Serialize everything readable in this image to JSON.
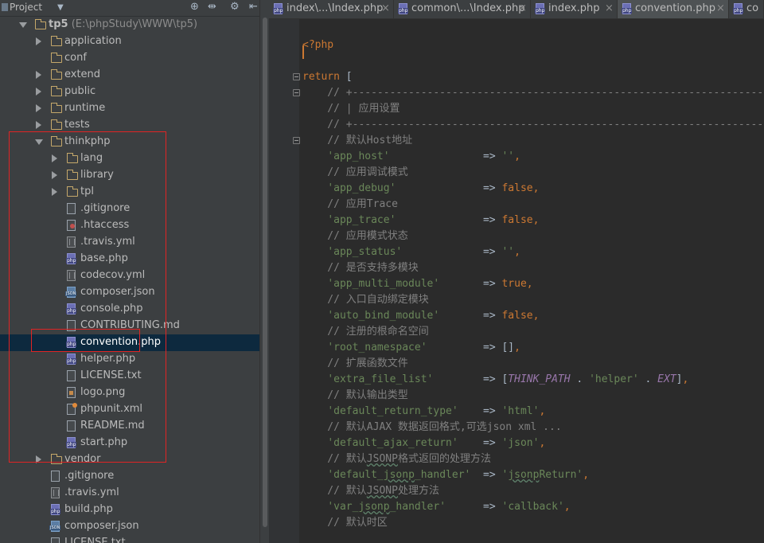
{
  "project_panel": {
    "title": "Project",
    "tree": [
      {
        "label": "tp5",
        "path": " (E:\\phpStudy\\WWW\\tp5)",
        "type": "folder",
        "depth": 0,
        "state": "expanded",
        "root": true
      },
      {
        "label": "application",
        "type": "folder",
        "depth": 1,
        "state": "collapsed"
      },
      {
        "label": "conf",
        "type": "folder",
        "depth": 1,
        "state": "none"
      },
      {
        "label": "extend",
        "type": "folder",
        "depth": 1,
        "state": "collapsed"
      },
      {
        "label": "public",
        "type": "folder",
        "depth": 1,
        "state": "collapsed"
      },
      {
        "label": "runtime",
        "type": "folder",
        "depth": 1,
        "state": "collapsed"
      },
      {
        "label": "tests",
        "type": "folder",
        "depth": 1,
        "state": "collapsed"
      },
      {
        "label": "thinkphp",
        "type": "folder",
        "depth": 1,
        "state": "expanded"
      },
      {
        "label": "lang",
        "type": "folder",
        "depth": 2,
        "state": "collapsed"
      },
      {
        "label": "library",
        "type": "folder",
        "depth": 2,
        "state": "collapsed"
      },
      {
        "label": "tpl",
        "type": "folder",
        "depth": 2,
        "state": "collapsed"
      },
      {
        "label": ".gitignore",
        "type": "file",
        "depth": 2
      },
      {
        "label": ".htaccess",
        "type": "htaccess",
        "depth": 2
      },
      {
        "label": ".travis.yml",
        "type": "yml",
        "depth": 2
      },
      {
        "label": "base.php",
        "type": "php",
        "depth": 2
      },
      {
        "label": "codecov.yml",
        "type": "yml",
        "depth": 2
      },
      {
        "label": "composer.json",
        "type": "json",
        "depth": 2
      },
      {
        "label": "console.php",
        "type": "php",
        "depth": 2
      },
      {
        "label": "CONTRIBUTING.md",
        "type": "file",
        "depth": 2
      },
      {
        "label": "convention.php",
        "type": "php",
        "depth": 2,
        "selected": true
      },
      {
        "label": "helper.php",
        "type": "php",
        "depth": 2
      },
      {
        "label": "LICENSE.txt",
        "type": "file",
        "depth": 2
      },
      {
        "label": "logo.png",
        "type": "img",
        "depth": 2
      },
      {
        "label": "phpunit.xml",
        "type": "xml",
        "depth": 2
      },
      {
        "label": "README.md",
        "type": "file",
        "depth": 2
      },
      {
        "label": "start.php",
        "type": "php",
        "depth": 2
      },
      {
        "label": "vendor",
        "type": "folder",
        "depth": 1,
        "state": "collapsed"
      },
      {
        "label": ".gitignore",
        "type": "file",
        "depth": 1
      },
      {
        "label": ".travis.yml",
        "type": "yml",
        "depth": 1
      },
      {
        "label": "build.php",
        "type": "php",
        "depth": 1
      },
      {
        "label": "composer.json",
        "type": "json",
        "depth": 1
      },
      {
        "label": "LICENSE.txt",
        "type": "file",
        "depth": 1
      }
    ]
  },
  "tabs": [
    {
      "label": "index\\...\\Index.php",
      "active": false
    },
    {
      "label": "common\\...\\Index.php",
      "active": false
    },
    {
      "label": "index.php",
      "active": false
    },
    {
      "label": "convention.php",
      "active": true
    },
    {
      "label": "co",
      "active": false
    }
  ],
  "tab_close_glyph": "×",
  "code_lines": [
    [],
    [
      {
        "t": "<?php",
        "c": "tag"
      }
    ],
    [],
    [
      {
        "t": "return ",
        "c": "kw"
      },
      {
        "t": "[",
        "c": "op"
      }
    ],
    [
      {
        "t": "    // +----------------------------------------------------------------------",
        "c": "cm"
      }
    ],
    [
      {
        "t": "    // | 应用设置",
        "c": "cm"
      }
    ],
    [
      {
        "t": "    // +----------------------------------------------------------------------",
        "c": "cm"
      }
    ],
    [
      {
        "t": "    // 默认Host地址",
        "c": "cm"
      }
    ],
    [
      {
        "t": "    ",
        "c": "op"
      },
      {
        "t": "'app_host'",
        "c": "str"
      },
      {
        "t": "               => ",
        "c": "op"
      },
      {
        "t": "''",
        "c": "str"
      },
      {
        "t": ",",
        "c": "kw"
      }
    ],
    [
      {
        "t": "    // 应用调试模式",
        "c": "cm"
      }
    ],
    [
      {
        "t": "    ",
        "c": "op"
      },
      {
        "t": "'app_debug'",
        "c": "str"
      },
      {
        "t": "              => ",
        "c": "op"
      },
      {
        "t": "false",
        "c": "kw"
      },
      {
        "t": ",",
        "c": "kw"
      }
    ],
    [
      {
        "t": "    // 应用Trace",
        "c": "cm"
      }
    ],
    [
      {
        "t": "    ",
        "c": "op"
      },
      {
        "t": "'app_trace'",
        "c": "str"
      },
      {
        "t": "              => ",
        "c": "op"
      },
      {
        "t": "false",
        "c": "kw"
      },
      {
        "t": ",",
        "c": "kw"
      }
    ],
    [
      {
        "t": "    // 应用模式状态",
        "c": "cm"
      }
    ],
    [
      {
        "t": "    ",
        "c": "op"
      },
      {
        "t": "'app_status'",
        "c": "str"
      },
      {
        "t": "             => ",
        "c": "op"
      },
      {
        "t": "''",
        "c": "str"
      },
      {
        "t": ",",
        "c": "kw"
      }
    ],
    [
      {
        "t": "    // 是否支持多模块",
        "c": "cm"
      }
    ],
    [
      {
        "t": "    ",
        "c": "op"
      },
      {
        "t": "'app_multi_module'",
        "c": "str"
      },
      {
        "t": "       => ",
        "c": "op"
      },
      {
        "t": "true",
        "c": "kw"
      },
      {
        "t": ",",
        "c": "kw"
      }
    ],
    [
      {
        "t": "    // 入口自动绑定模块",
        "c": "cm"
      }
    ],
    [
      {
        "t": "    ",
        "c": "op"
      },
      {
        "t": "'auto_bind_module'",
        "c": "str"
      },
      {
        "t": "       => ",
        "c": "op"
      },
      {
        "t": "false",
        "c": "kw"
      },
      {
        "t": ",",
        "c": "kw"
      }
    ],
    [
      {
        "t": "    // 注册的根命名空间",
        "c": "cm"
      }
    ],
    [
      {
        "t": "    ",
        "c": "op"
      },
      {
        "t": "'root_namespace'",
        "c": "str"
      },
      {
        "t": "         => ",
        "c": "op"
      },
      {
        "t": "[]",
        "c": "op"
      },
      {
        "t": ",",
        "c": "kw"
      }
    ],
    [
      {
        "t": "    // 扩展函数文件",
        "c": "cm"
      }
    ],
    [
      {
        "t": "    ",
        "c": "op"
      },
      {
        "t": "'extra_file_list'",
        "c": "str"
      },
      {
        "t": "        => ",
        "c": "op"
      },
      {
        "t": "[",
        "c": "op"
      },
      {
        "t": "THINK_PATH",
        "c": "const"
      },
      {
        "t": " . ",
        "c": "op"
      },
      {
        "t": "'helper'",
        "c": "str"
      },
      {
        "t": " . ",
        "c": "op"
      },
      {
        "t": "EXT",
        "c": "const"
      },
      {
        "t": "]",
        "c": "op"
      },
      {
        "t": ",",
        "c": "kw"
      }
    ],
    [
      {
        "t": "    // 默认输出类型",
        "c": "cm"
      }
    ],
    [
      {
        "t": "    ",
        "c": "op"
      },
      {
        "t": "'default_return_type'",
        "c": "str"
      },
      {
        "t": "    => ",
        "c": "op"
      },
      {
        "t": "'html'",
        "c": "str"
      },
      {
        "t": ",",
        "c": "kw"
      }
    ],
    [
      {
        "t": "    // 默认AJAX 数据返回格式,可选json xml ...",
        "c": "cm"
      }
    ],
    [
      {
        "t": "    ",
        "c": "op"
      },
      {
        "t": "'default_ajax_return'",
        "c": "str"
      },
      {
        "t": "    => ",
        "c": "op"
      },
      {
        "t": "'json'",
        "c": "str"
      },
      {
        "t": ",",
        "c": "kw"
      }
    ],
    [
      {
        "t": "    // 默认",
        "c": "cm"
      },
      {
        "t": "JSONP",
        "c": "cm wavy"
      },
      {
        "t": "格式返回的处理方法",
        "c": "cm"
      }
    ],
    [
      {
        "t": "    ",
        "c": "op"
      },
      {
        "t": "'default_",
        "c": "str"
      },
      {
        "t": "jsonp",
        "c": "str wavy"
      },
      {
        "t": "_handler'",
        "c": "str"
      },
      {
        "t": "  => ",
        "c": "op"
      },
      {
        "t": "'",
        "c": "str"
      },
      {
        "t": "jsonp",
        "c": "str wavy"
      },
      {
        "t": "Return'",
        "c": "str"
      },
      {
        "t": ",",
        "c": "kw"
      }
    ],
    [
      {
        "t": "    // 默认",
        "c": "cm"
      },
      {
        "t": "JSONP",
        "c": "cm wavy"
      },
      {
        "t": "处理方法",
        "c": "cm"
      }
    ],
    [
      {
        "t": "    ",
        "c": "op"
      },
      {
        "t": "'var_",
        "c": "str"
      },
      {
        "t": "jsonp",
        "c": "str wavy"
      },
      {
        "t": "_handler'",
        "c": "str"
      },
      {
        "t": "      => ",
        "c": "op"
      },
      {
        "t": "'callback'",
        "c": "str"
      },
      {
        "t": ",",
        "c": "kw"
      }
    ],
    [
      {
        "t": "    // 默认时区",
        "c": "cm"
      }
    ]
  ]
}
